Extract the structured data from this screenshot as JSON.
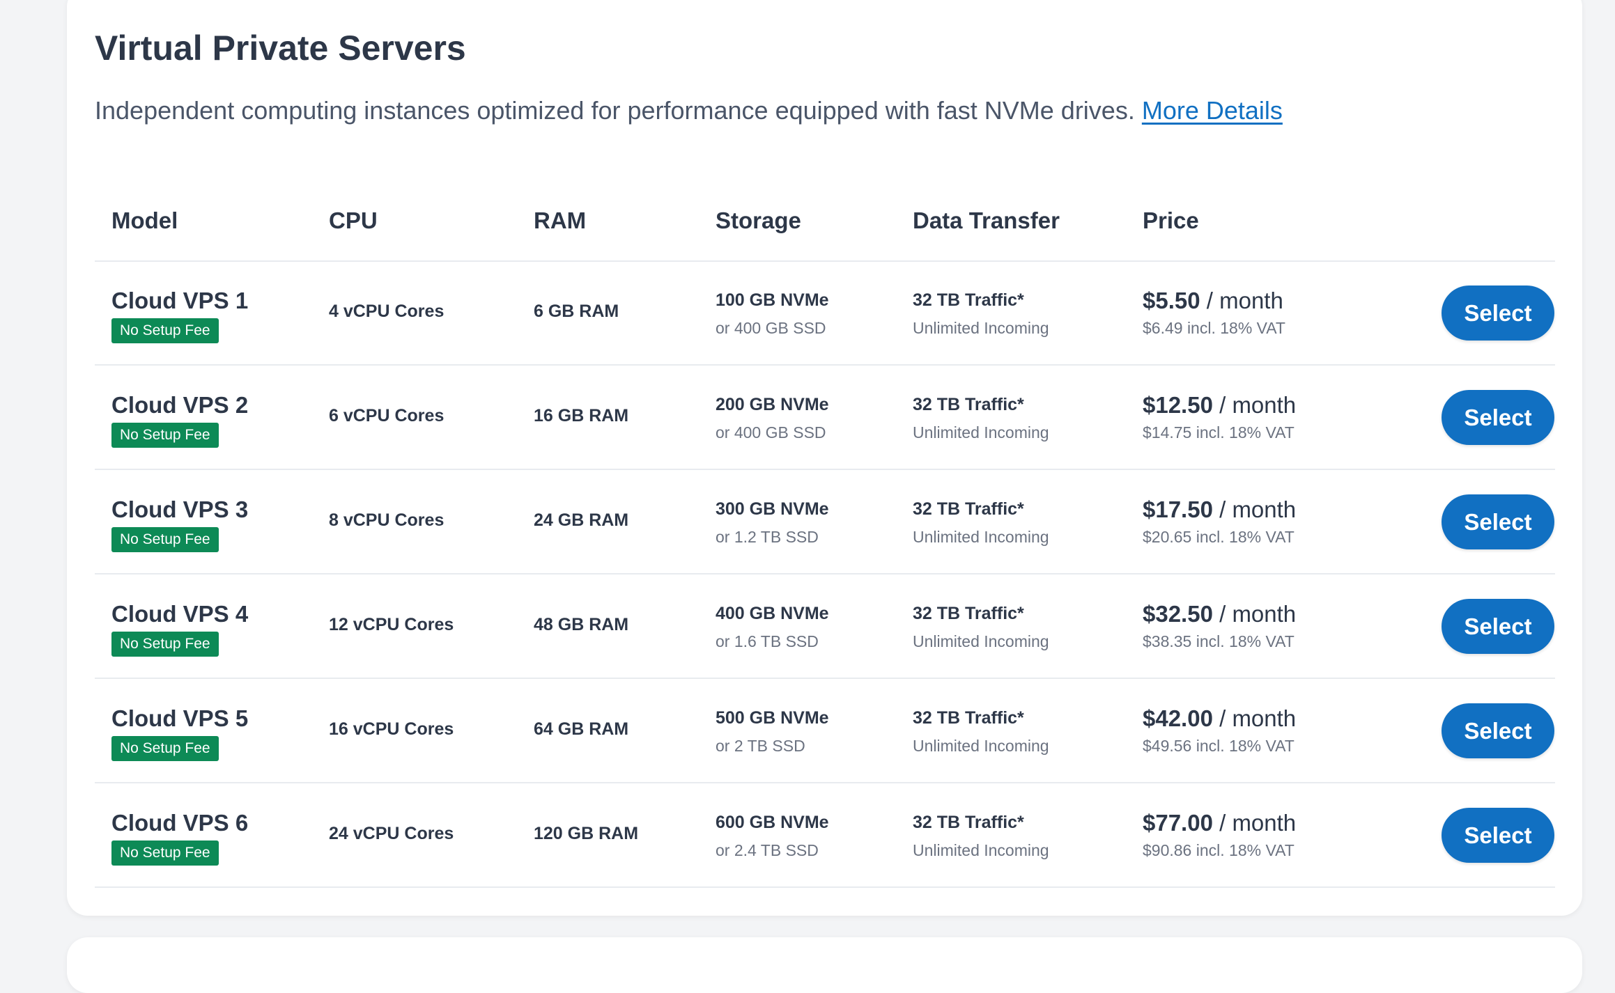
{
  "header": {
    "title": "Virtual Private Servers",
    "description": "Independent computing instances optimized for performance equipped with fast NVMe drives.",
    "details_link": "More Details"
  },
  "table": {
    "columns": [
      "Model",
      "CPU",
      "RAM",
      "Storage",
      "Data Transfer",
      "Price"
    ],
    "rows": [
      {
        "model": "Cloud VPS 1",
        "badge": "No Setup Fee",
        "cpu": "4 vCPU Cores",
        "ram": "6 GB RAM",
        "storage": "100 GB NVMe",
        "storage_alt": "or 400 GB SSD",
        "traffic": "32 TB Traffic*",
        "incoming": "Unlimited Incoming",
        "price": "$5.50",
        "period": "/ month",
        "vat": "$6.49 incl. 18% VAT",
        "action": "Select"
      },
      {
        "model": "Cloud VPS 2",
        "badge": "No Setup Fee",
        "cpu": "6 vCPU Cores",
        "ram": "16 GB RAM",
        "storage": "200 GB NVMe",
        "storage_alt": "or 400 GB SSD",
        "traffic": "32 TB Traffic*",
        "incoming": "Unlimited Incoming",
        "price": "$12.50",
        "period": "/ month",
        "vat": "$14.75 incl. 18% VAT",
        "action": "Select"
      },
      {
        "model": "Cloud VPS 3",
        "badge": "No Setup Fee",
        "cpu": "8 vCPU Cores",
        "ram": "24 GB RAM",
        "storage": "300 GB NVMe",
        "storage_alt": "or 1.2 TB SSD",
        "traffic": "32 TB Traffic*",
        "incoming": "Unlimited Incoming",
        "price": "$17.50",
        "period": "/ month",
        "vat": "$20.65 incl. 18% VAT",
        "action": "Select"
      },
      {
        "model": "Cloud VPS 4",
        "badge": "No Setup Fee",
        "cpu": "12 vCPU Cores",
        "ram": "48 GB RAM",
        "storage": "400 GB NVMe",
        "storage_alt": "or 1.6 TB SSD",
        "traffic": "32 TB Traffic*",
        "incoming": "Unlimited Incoming",
        "price": "$32.50",
        "period": "/ month",
        "vat": "$38.35 incl. 18% VAT",
        "action": "Select"
      },
      {
        "model": "Cloud VPS 5",
        "badge": "No Setup Fee",
        "cpu": "16 vCPU Cores",
        "ram": "64 GB RAM",
        "storage": "500 GB NVMe",
        "storage_alt": "or 2 TB SSD",
        "traffic": "32 TB Traffic*",
        "incoming": "Unlimited Incoming",
        "price": "$42.00",
        "period": "/ month",
        "vat": "$49.56 incl. 18% VAT",
        "action": "Select"
      },
      {
        "model": "Cloud VPS 6",
        "badge": "No Setup Fee",
        "cpu": "24 vCPU Cores",
        "ram": "120 GB RAM",
        "storage": "600 GB NVMe",
        "storage_alt": "or 2.4 TB SSD",
        "traffic": "32 TB Traffic*",
        "incoming": "Unlimited Incoming",
        "price": "$77.00",
        "period": "/ month",
        "vat": "$90.86 incl. 18% VAT",
        "action": "Select"
      }
    ]
  },
  "colors": {
    "accent": "#1170c2",
    "badge": "#0d8a56",
    "text": "#2d3748",
    "muted": "#6b7280"
  }
}
